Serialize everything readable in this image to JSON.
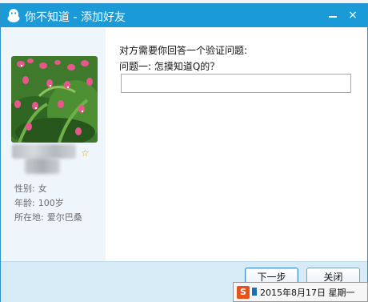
{
  "window": {
    "title": "你不知道 - 添加好友",
    "close_glyph": "×"
  },
  "profile": {
    "gender_label": "性别:",
    "gender_value": "女",
    "age_label": "年龄:",
    "age_value": "100岁",
    "location_label": "所在地:",
    "location_value": "爱尔巴桑"
  },
  "verification": {
    "prompt": "对方需要你回答一个验证问题:",
    "question": "问题一: 怎摸知道Q的？",
    "answer_value": ""
  },
  "buttons": {
    "next_label": "下一步",
    "close_label": "关闭"
  },
  "taskbar": {
    "sogou_glyph": "S",
    "date_tooltip": "2015年8月17日 星期一"
  },
  "colors": {
    "titlebar": "#1a9bd7",
    "footer": "#d7ebf7",
    "sidebar": "#eef6fb"
  }
}
